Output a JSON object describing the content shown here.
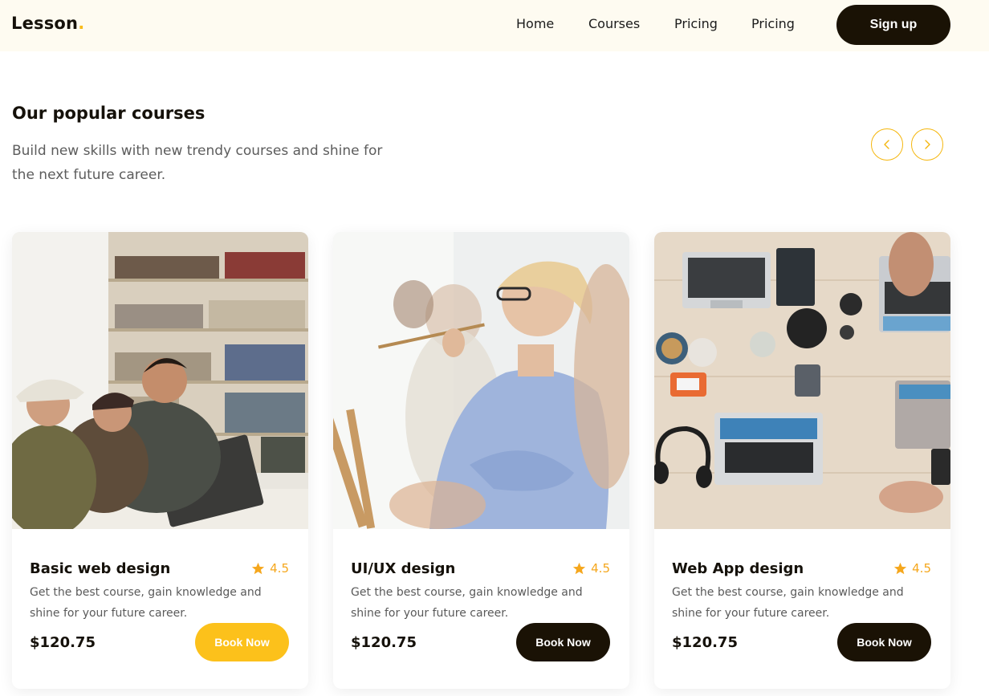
{
  "brand": {
    "name": "Lesson",
    "dot": ".",
    "accent": "#f8bb1a"
  },
  "nav": {
    "links": [
      "Home",
      "Courses",
      "Pricing",
      "Pricing"
    ],
    "signup_label": "Sign up"
  },
  "section": {
    "title": "Our popular courses",
    "subtitle": "Build new skills with new trendy courses and shine for the next future career."
  },
  "carousel": {
    "prev_icon": "chevron-left-icon",
    "next_icon": "chevron-right-icon"
  },
  "courses": [
    {
      "title": "Basic web design",
      "rating": "4.5",
      "description": "Get the best course, gain knowledge and shine for your future career.",
      "price": "$120.75",
      "button": "Book Now",
      "button_style": "yellow"
    },
    {
      "title": "UI/UX design",
      "rating": "4.5",
      "description": "Get the best course, gain knowledge and shine for your future career.",
      "price": "$120.75",
      "button": "Book Now",
      "button_style": "dark"
    },
    {
      "title": "Web App design",
      "rating": "4.5",
      "description": "Get the best course, gain knowledge and shine for your future career.",
      "price": "$120.75",
      "button": "Book Now",
      "button_style": "dark"
    }
  ],
  "colors": {
    "header_bg": "#fefbf1",
    "dark": "#1a1205",
    "yellow": "#fcc11b",
    "star": "#f5a71d"
  }
}
